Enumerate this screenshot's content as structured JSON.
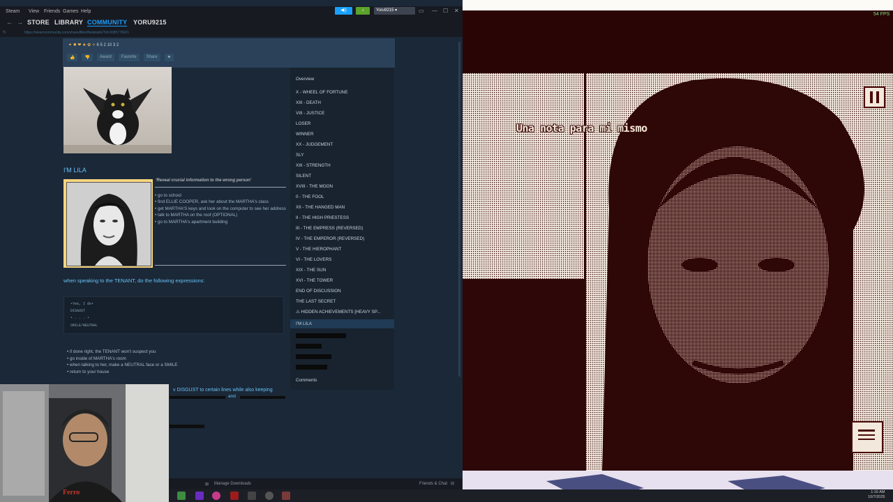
{
  "topmenu": {
    "app": "Steam",
    "view": "View",
    "friends": "Friends",
    "games": "Games",
    "help": "Help"
  },
  "nav": {
    "back": "←",
    "forward": "→",
    "store": "STORE",
    "library": "LIBRARY",
    "community": "COMMUNITY",
    "user": "YORU9215"
  },
  "titlebar": {
    "user": "Yoru9215",
    "minimize": "—",
    "maximize": "☐",
    "close": "✕"
  },
  "url": "https://steamcommunity.com/sharedfiles/filedetails/?id=3085776621",
  "guide": {
    "awards": "6  5  2  10  3  2",
    "buttons": [
      "Award",
      "Favorite",
      "Share"
    ],
    "section_title": "I'M LILA",
    "quote": "'Reveal crucial information to the wrong person'",
    "steps": [
      "go to school",
      "find ELLIE COOPER, ask her about the MARTHA's class",
      "get MARTHA'S keys and look on the computer to see her address",
      "talk to MARTHA on the roof (OPTIONAL)",
      "go to MARTHA's apartment building"
    ],
    "speaking": "when speaking to the TENANT, do the following expressions:",
    "code": [
      "•Yes, I do•",
      "DISGUST",
      "• . . . •",
      "SMILE/NEUTRAL"
    ],
    "bullets": [
      "if done right, the TENANT won't suspect you",
      "go inside of MARTHA's room",
      "when talking to her, make a NEUTRAL face or a SMILE",
      "return to your house"
    ],
    "disgust_line": "v DISGUST to certain lines while also keeping",
    "and": "and"
  },
  "toc": {
    "overview": "Overview",
    "items": [
      "X - WHEEL OF FORTUNE",
      "XIII - DEATH",
      "VIII - JUSTICE",
      "LOSER",
      "WINNER",
      "XX - JUDGEMENT",
      "SLY",
      "XIII - STRENGTH",
      "SILENT",
      "XVIII - THE MOON",
      "0 - THE FOOL",
      "XII - THE HANGED MAN",
      "II - THE HIGH PRIESTESS",
      "III - THE EMPRESS (REVERSED)",
      "IV - THE EMPEROR (REVERSED)",
      "V - THE HIEROPHANT",
      "VI - THE LOVERS",
      "XIX - THE SUN",
      "XVI - THE TOWER",
      "END OF DISCUSSION",
      "THE LAST SECRET",
      "⚠ HIDDEN ACHIEVEMENTS [HEAVY SP..."
    ],
    "selected": "I'M LILA",
    "comments": "Comments"
  },
  "status": {
    "downloads": "Manage Downloads",
    "friends": "Friends & Chat"
  },
  "game": {
    "fps": "54 FPS",
    "subtitle": "Una nota para mi mismo"
  },
  "clock": {
    "time": "1:16 AM",
    "date": "10/7/2025"
  }
}
